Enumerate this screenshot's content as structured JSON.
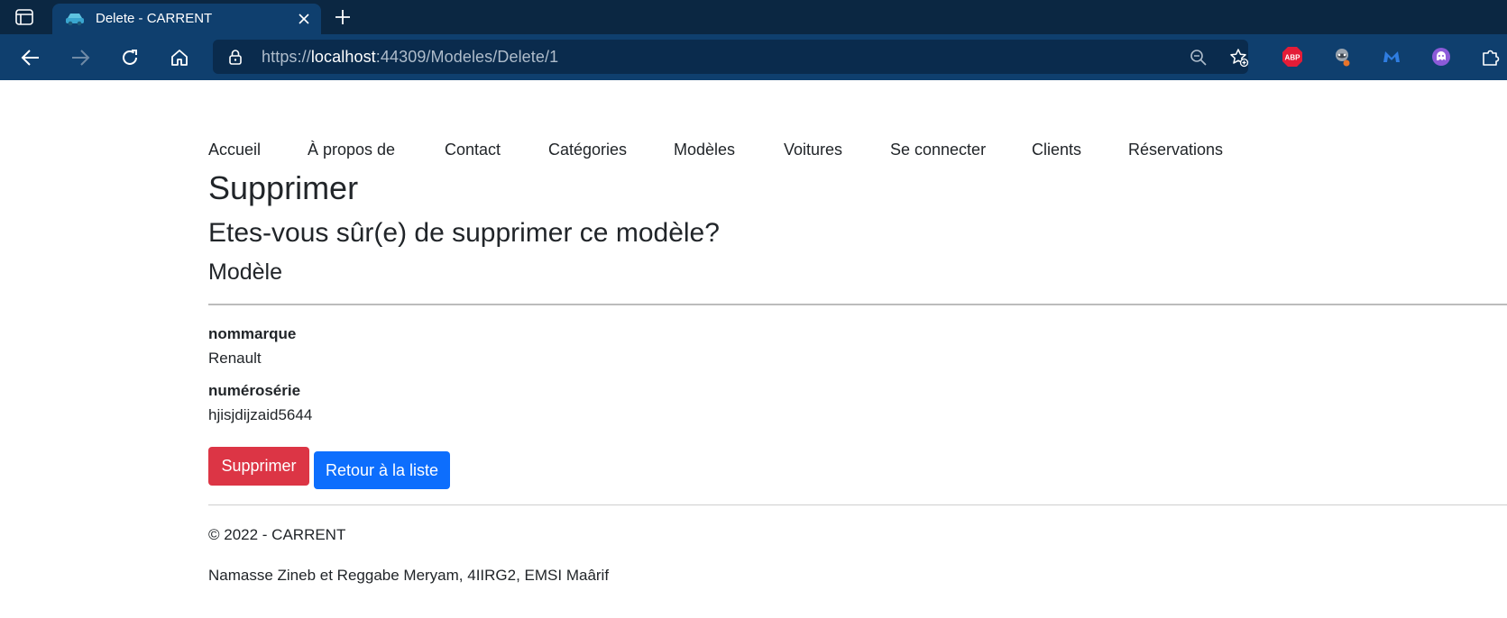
{
  "browser": {
    "tab": {
      "title": "Delete - CARRENT"
    },
    "address": {
      "prefix": "https://",
      "host": "localhost",
      "rest": ":44309/Modeles/Delete/1"
    },
    "extensions": {
      "abp_label": "ABP"
    }
  },
  "nav": {
    "items": [
      "Accueil",
      "À propos de",
      "Contact",
      "Catégories",
      "Modèles",
      "Voitures",
      "Se connecter",
      "Clients",
      "Réservations"
    ]
  },
  "page": {
    "title": "Supprimer",
    "confirm": "Etes-vous sûr(e) de supprimer ce modèle?",
    "entity": "Modèle",
    "fields": [
      {
        "label": "nommarque",
        "value": "Renault"
      },
      {
        "label": "numérosérie",
        "value": "hjisjdijzaid5644"
      }
    ],
    "delete_label": "Supprimer",
    "back_label": "Retour à la liste"
  },
  "footer": {
    "copyright": "© 2022 - CARRENT",
    "authors": "Namasse Zineb et Reggabe Meryam, 4IIRG2, EMSI Maârif"
  }
}
